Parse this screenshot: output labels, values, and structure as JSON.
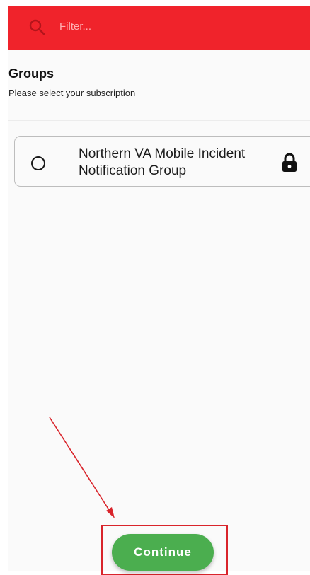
{
  "header": {
    "search_icon": "search-icon",
    "filter_placeholder": "Filter...",
    "background_color": "#f0232b"
  },
  "groups": {
    "title": "Groups",
    "subtitle": "Please select your subscription",
    "items": [
      {
        "name": "Northern VA Mobile Incident Notification Group",
        "selected": false,
        "locked": true,
        "lock_icon": "lock-icon"
      }
    ]
  },
  "footer": {
    "continue_label": "Continue",
    "button_color": "#4bae4f"
  },
  "annotation": {
    "color": "#d9242b"
  }
}
